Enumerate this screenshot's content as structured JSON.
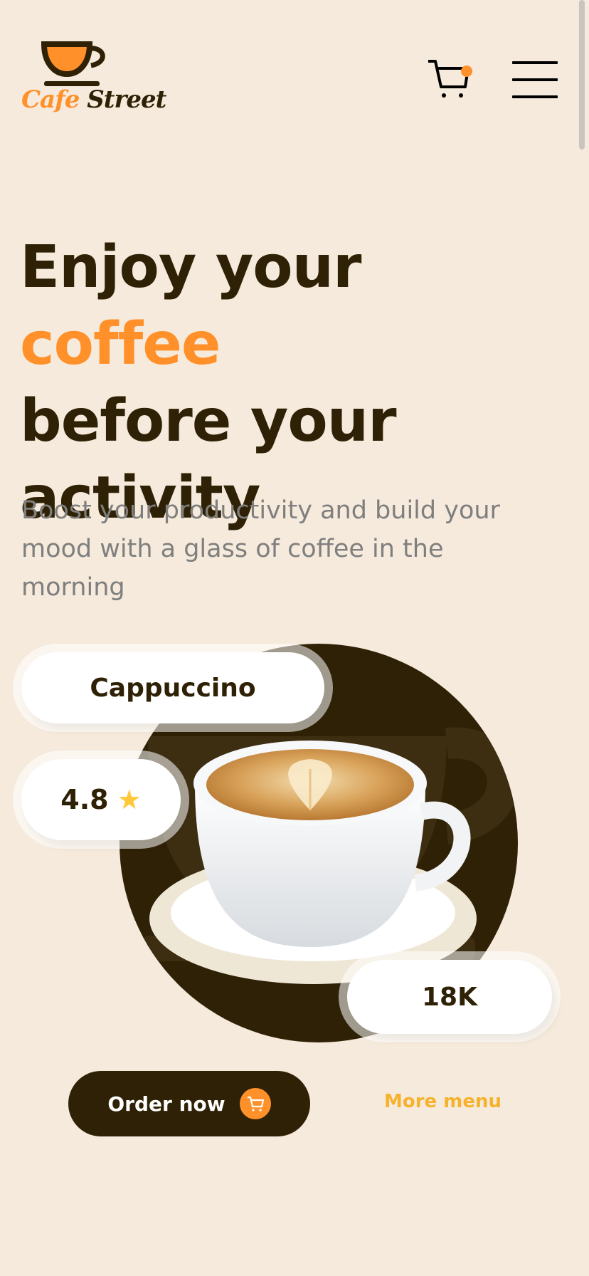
{
  "header": {
    "logo_word_1": "Cafe",
    "logo_word_2": "Street",
    "cart_icon": "shopping-cart-icon",
    "menu_icon": "hamburger-menu-icon"
  },
  "hero": {
    "title_part_1": "Enjoy your ",
    "title_accent": "coffee",
    "title_part_2": "before your activity",
    "subtitle": "Boost your productivity and build your mood with a glass of coffee in the morning"
  },
  "product": {
    "name": "Cappuccino",
    "rating": "4.8",
    "rating_icon": "star-icon",
    "count": "18K"
  },
  "actions": {
    "order_label": "Order now",
    "order_icon": "shopping-cart-icon",
    "more_label": "More menu"
  },
  "colors": {
    "background": "#F5EADB",
    "dark_brown": "#2F2105",
    "accent_orange": "#FF902A",
    "link_yellow": "#F6B22D",
    "subtitle_gray": "#7F7F7F",
    "star": "#FFC83A"
  }
}
